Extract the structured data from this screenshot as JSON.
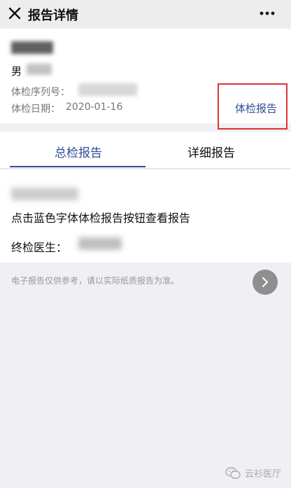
{
  "header": {
    "title": "报告详情",
    "close_icon": "close-icon",
    "more_icon": "more-icon"
  },
  "patient": {
    "gender": "男",
    "serial_label": "体检序列号：",
    "date_label": "体检日期：",
    "date_value": "2020-01-16"
  },
  "actions": {
    "report_link": "体检报告"
  },
  "tabs": [
    {
      "label": "总检报告",
      "active": true
    },
    {
      "label": "详细报告",
      "active": false
    }
  ],
  "summary": {
    "instruction": "点击蓝色字体体检报告按钮查看报告",
    "doctor_label": "终检医生："
  },
  "footer": {
    "disclaimer": "电子报告仅供参考，请以实际纸质报告为准。"
  },
  "watermark": {
    "text": "云衫医厅"
  },
  "colors": {
    "accent": "#2c4f95",
    "highlight_border": "#dd3333",
    "background": "#efeff4"
  }
}
